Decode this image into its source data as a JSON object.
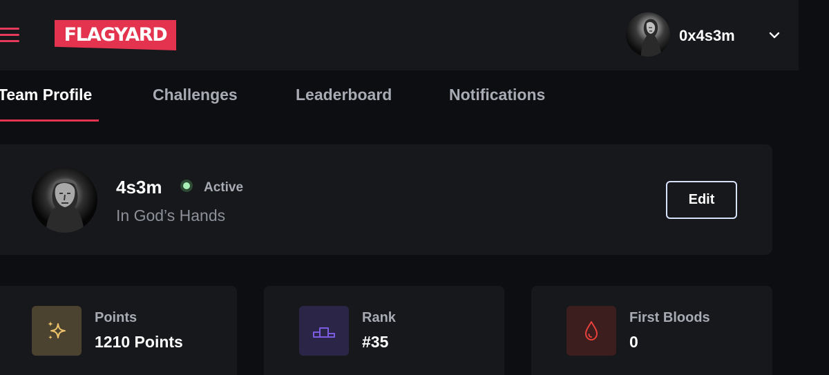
{
  "header": {
    "logo_text": "FLAGYARD",
    "username": "0x4s3m",
    "accent_color": "#e3334f"
  },
  "tabs": [
    {
      "label": "Team Profile",
      "active": true
    },
    {
      "label": "Challenges",
      "active": false
    },
    {
      "label": "Leaderboard",
      "active": false
    },
    {
      "label": "Notifications",
      "active": false
    }
  ],
  "profile": {
    "team_name": "4s3m",
    "status": "Active",
    "status_color": "#a8f0b5",
    "motto": "In God’s Hands",
    "edit_label": "Edit"
  },
  "stats": [
    {
      "label": "Points",
      "value": "1210 Points",
      "icon": "sparkles-icon",
      "color": "#f0c46b"
    },
    {
      "label": "Rank",
      "value": "#35",
      "icon": "podium-icon",
      "color": "#7c5ce0"
    },
    {
      "label": "First Bloods",
      "value": "0",
      "icon": "blood-drop-icon",
      "color": "#e8413a"
    }
  ]
}
